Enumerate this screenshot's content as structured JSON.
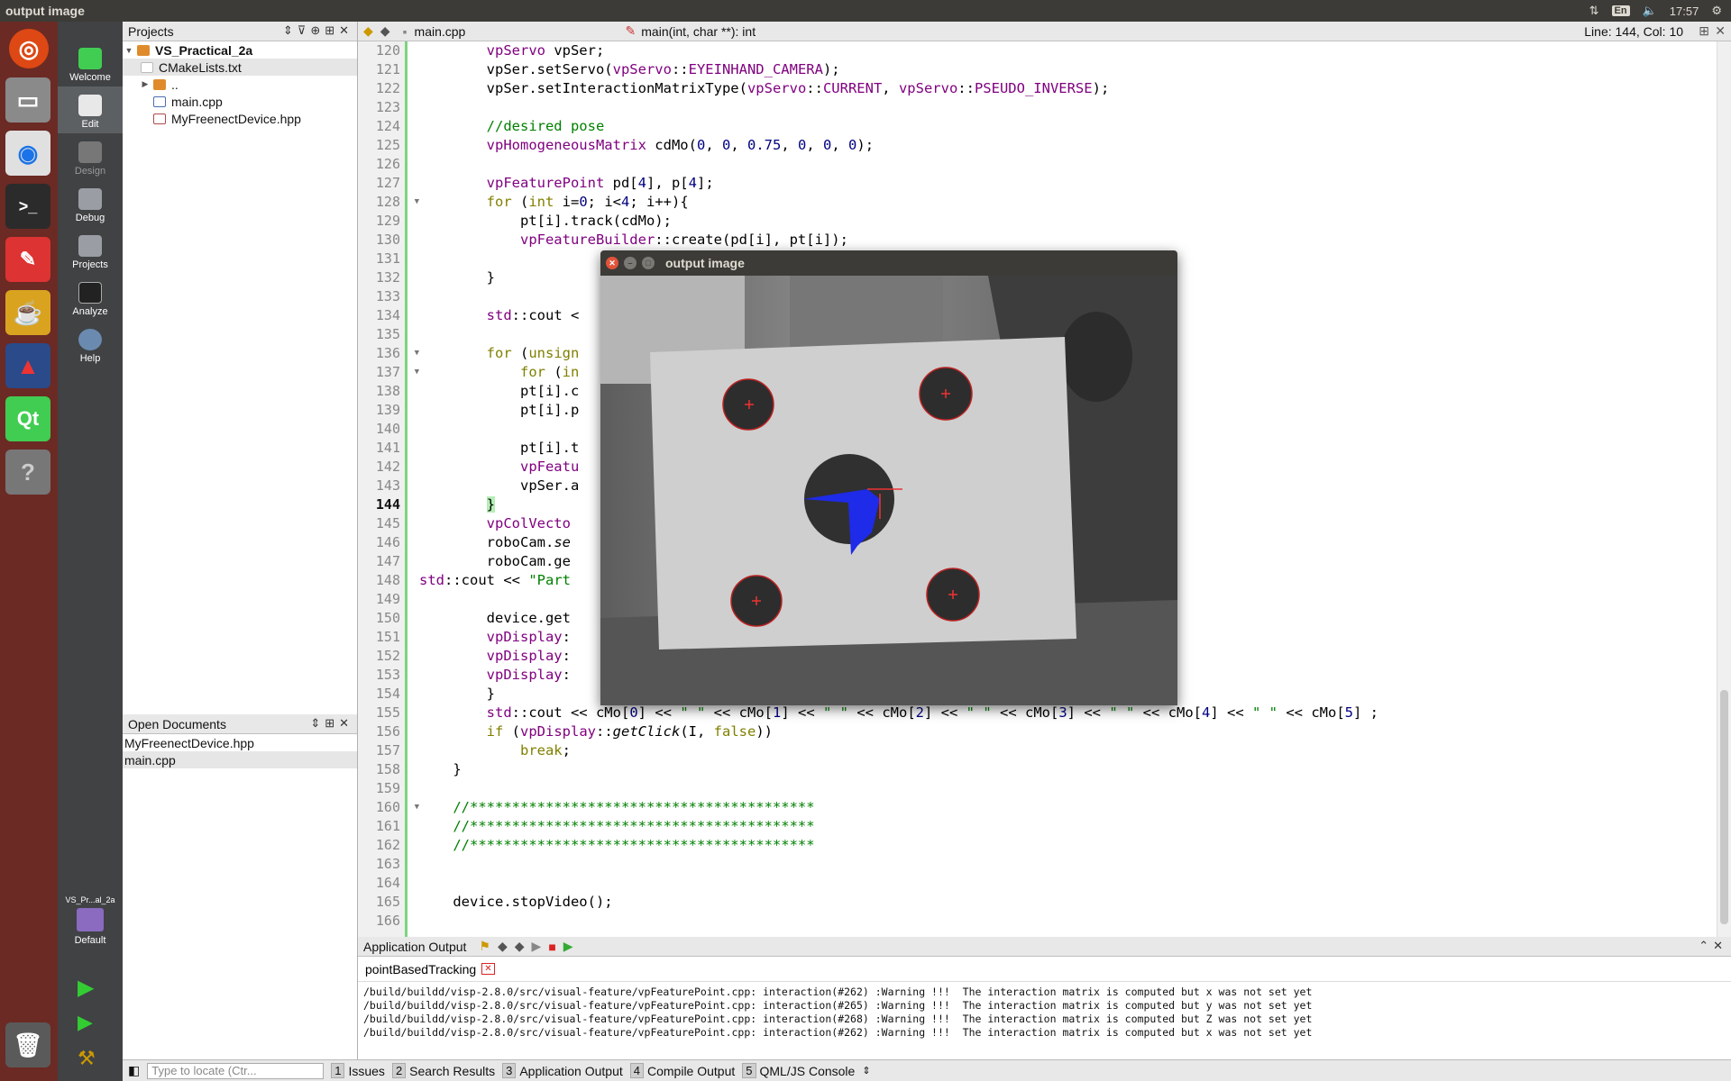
{
  "window": {
    "title": "output image"
  },
  "tray": {
    "kbd": "En",
    "clock": "17:57"
  },
  "modes": [
    {
      "label": "Welcome"
    },
    {
      "label": "Edit"
    },
    {
      "label": "Design"
    },
    {
      "label": "Debug"
    },
    {
      "label": "Projects"
    },
    {
      "label": "Analyze"
    },
    {
      "label": "Help"
    }
  ],
  "kit": {
    "project": "VS_Pr...al_2a",
    "label": "Default"
  },
  "projects": {
    "title": "Projects",
    "root": "VS_Practical_2a",
    "items": [
      "CMakeLists.txt",
      "..",
      "main.cpp",
      "MyFreenectDevice.hpp"
    ]
  },
  "open_docs": {
    "title": "Open Documents",
    "items": [
      "MyFreenectDevice.hpp",
      "main.cpp"
    ]
  },
  "editor": {
    "file": "main.cpp",
    "symbol": "main(int, char **): int",
    "position": "Line: 144, Col: 10",
    "line_numbers": [
      "120",
      "121",
      "122",
      "123",
      "124",
      "125",
      "126",
      "127",
      "128",
      "129",
      "130",
      "131",
      "132",
      "133",
      "134",
      "135",
      "136",
      "137",
      "138",
      "139",
      "140",
      "141",
      "142",
      "143",
      "144",
      "145",
      "146",
      "147",
      "148",
      "149",
      "150",
      "151",
      "152",
      "153",
      "154",
      "155",
      "156",
      "157",
      "158",
      "159",
      "160",
      "161",
      "162",
      "163",
      "164",
      "165",
      "166"
    ]
  },
  "dialog": {
    "title": "output image"
  },
  "output": {
    "title": "Application Output",
    "tab": "pointBasedTracking",
    "lines": [
      "/build/buildd/visp-2.8.0/src/visual-feature/vpFeaturePoint.cpp: interaction(#262) :Warning !!!  The interaction matrix is computed but x was not set yet",
      "/build/buildd/visp-2.8.0/src/visual-feature/vpFeaturePoint.cpp: interaction(#265) :Warning !!!  The interaction matrix is computed but y was not set yet",
      "/build/buildd/visp-2.8.0/src/visual-feature/vpFeaturePoint.cpp: interaction(#268) :Warning !!!  The interaction matrix is computed but Z was not set yet",
      "/build/buildd/visp-2.8.0/src/visual-feature/vpFeaturePoint.cpp: interaction(#262) :Warning !!!  The interaction matrix is computed but x was not set yet"
    ]
  },
  "statusbar": {
    "locator_placeholder": "Type to locate (Ctr...",
    "tabs": [
      {
        "n": "1",
        "label": "Issues"
      },
      {
        "n": "2",
        "label": "Search Results"
      },
      {
        "n": "3",
        "label": "Application Output"
      },
      {
        "n": "4",
        "label": "Compile Output"
      },
      {
        "n": "5",
        "label": "QML/JS Console"
      }
    ]
  }
}
